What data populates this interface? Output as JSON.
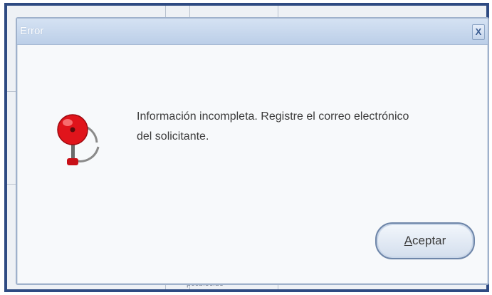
{
  "background": {
    "cell_text": "pccblecide"
  },
  "dialog": {
    "title": "Error",
    "close_label": "X",
    "message_line1": "Información incompleta. Registre el correo electrónico",
    "message_line2": "del solicitante.",
    "icon": "alarm-bell-icon",
    "accept_button": {
      "mnemonic": "A",
      "rest": "ceptar"
    }
  },
  "colors": {
    "window_border": "#2e4a82",
    "titlebar": "#c9d9ee",
    "bell_red": "#e0141b"
  }
}
